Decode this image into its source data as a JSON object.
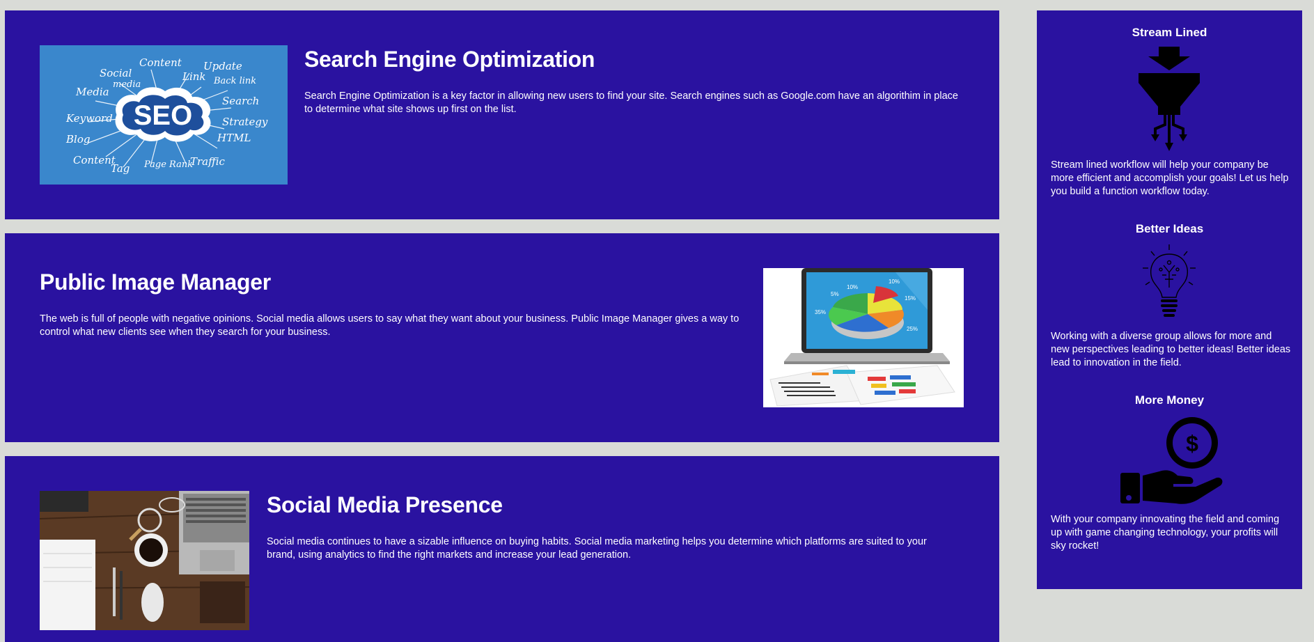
{
  "services": [
    {
      "title": "Search Engine Optimization",
      "text": "Search Engine Optimization is a key factor in allowing new users to find your site. Search engines such as Google.com have an algorithim in place to determine what site shows up first on the list.",
      "image_words": [
        "Social",
        "media",
        "Content",
        "Update",
        "Link",
        "Back link",
        "Media",
        "Search",
        "Keyword",
        "Strategy",
        "Blog",
        "HTML",
        "Content",
        "Tag",
        "Page Rank",
        "Traffic"
      ],
      "image_center": "SEO"
    },
    {
      "title": "Public Image Manager",
      "text": "The web is full of people with negative opinions. Social media allows users to say what they want about your business. Public Image Manager gives a way to control what new clients see when they search for your business.",
      "image_labels": [
        "10%",
        "10%",
        "5%",
        "15%",
        "35%",
        "25%"
      ]
    },
    {
      "title": "Social Media Presence",
      "text": "Social media continues to have a sizable influence on buying habits. Social media marketing helps you determine which platforms are suited to your brand, using analytics to find the right markets and increase your lead generation."
    }
  ],
  "benefits": [
    {
      "title": "Stream Lined",
      "icon": "funnel-icon",
      "text": "Stream lined workflow will help your company be more efficient and accomplish your goals! Let us help you build a function workflow today."
    },
    {
      "title": "Better Ideas",
      "icon": "lightbulb-icon",
      "text": "Working with a diverse group allows for more and new perspectives leading to better ideas! Better ideas lead to innovation in the field."
    },
    {
      "title": "More Money",
      "icon": "money-hand-icon",
      "text": "With your company innovating the field and coming up with game changing technology, your profits will sky rocket!"
    }
  ],
  "colors": {
    "background": "#d9dbd7",
    "panel": "#2a12a0",
    "seo_image": "#3a87cc"
  }
}
